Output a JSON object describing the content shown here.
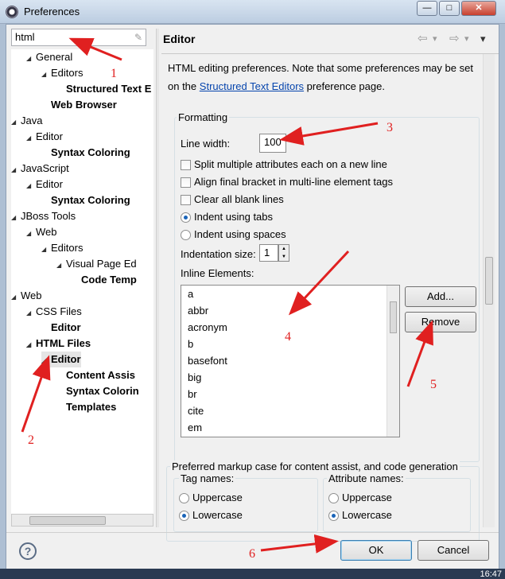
{
  "window": {
    "title": "Preferences",
    "controls": {
      "minimize": "—",
      "maximize": "□",
      "close": "✕"
    }
  },
  "search": {
    "value": "html",
    "clear_icon": "✎"
  },
  "tree": {
    "items": [
      {
        "label": "General",
        "expanded": true
      },
      {
        "label": "Editors",
        "expanded": true
      },
      {
        "label": "Structured Text E",
        "bold": true
      },
      {
        "label": "Web Browser",
        "bold": true
      },
      {
        "label": "Java",
        "expanded": true
      },
      {
        "label": "Editor",
        "expanded": true
      },
      {
        "label": "Syntax Coloring",
        "bold": true
      },
      {
        "label": "JavaScript",
        "expanded": true
      },
      {
        "label": "Editor",
        "expanded": true
      },
      {
        "label": "Syntax Coloring",
        "bold": true
      },
      {
        "label": "JBoss Tools",
        "expanded": true
      },
      {
        "label": "Web",
        "expanded": true
      },
      {
        "label": "Editors",
        "expanded": true
      },
      {
        "label": "Visual Page Ed",
        "expanded": true
      },
      {
        "label": "Code Temp",
        "bold": true
      },
      {
        "label": "Web",
        "expanded": true
      },
      {
        "label": "CSS Files",
        "expanded": true
      },
      {
        "label": "Editor",
        "bold": true
      },
      {
        "label": "HTML Files",
        "expanded": true,
        "bold": true
      },
      {
        "label": "Editor",
        "expanded": true,
        "bold": true,
        "selected": true
      },
      {
        "label": "Content Assis",
        "bold": true
      },
      {
        "label": "Syntax Colorin",
        "bold": true
      },
      {
        "label": "Templates",
        "bold": true
      }
    ]
  },
  "page": {
    "title": "Editor",
    "nav": {
      "back": "⇦",
      "back_menu": "▾",
      "forward": "⇨",
      "forward_menu": "▾",
      "view_menu": "▾"
    },
    "description_prefix": "HTML editing preferences.  Note that some preferences may be set on the",
    "description_link": "Structured Text Editors",
    "description_suffix": "preference page.",
    "formatting": {
      "legend": "Formatting",
      "line_width_label": "Line width:",
      "line_width_value": "100",
      "split_attributes": "Split multiple attributes each on a new line",
      "align_bracket": "Align final bracket in multi-line element tags",
      "clear_blank": "Clear all blank lines",
      "indent_tabs": "Indent using tabs",
      "indent_spaces": "Indent using spaces",
      "indentation_size_label": "Indentation size:",
      "indentation_size_value": "1",
      "inline_elements_label": "Inline Elements:",
      "inline_elements": [
        "a",
        "abbr",
        "acronym",
        "b",
        "basefont",
        "big",
        "br",
        "cite",
        "em"
      ],
      "add_button": "Add...",
      "remove_button": "Remove"
    },
    "markup_case": {
      "legend": "Preferred markup case for content assist, and code generation",
      "tag_names": {
        "legend": "Tag names:",
        "upper": "Uppercase",
        "lower": "Lowercase"
      },
      "attribute_names": {
        "legend": "Attribute names:",
        "upper": "Uppercase",
        "lower": "Lowercase"
      }
    }
  },
  "footer": {
    "help_icon": "?",
    "ok": "OK",
    "cancel": "Cancel"
  },
  "annotations": [
    "1",
    "2",
    "3",
    "4",
    "5",
    "6"
  ],
  "taskbar": {
    "clock": "16:47"
  },
  "colors": {
    "annotation": "#e02020",
    "link": "#0645ad",
    "radio_selected": "#1a64b8"
  }
}
